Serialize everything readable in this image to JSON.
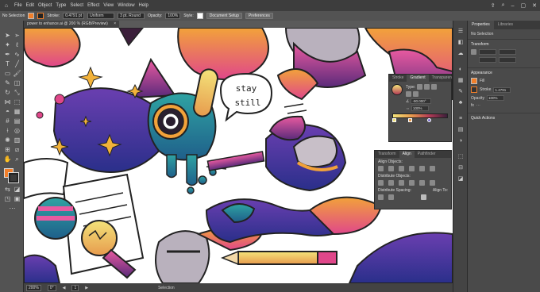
{
  "menubar": {
    "items": [
      "File",
      "Edit",
      "Object",
      "Type",
      "Select",
      "Effect",
      "View",
      "Window",
      "Help"
    ],
    "right_icons": [
      "share-icon",
      "search-icon",
      "minimize-icon",
      "maximize-icon",
      "close-icon"
    ]
  },
  "ctrlbar": {
    "selection_label": "No Selection",
    "stroke_label": "Stroke:",
    "stroke_value": "0.4791 pt",
    "uniform_label": "Uniform",
    "brush_label": "3 pt. Round",
    "opacity_label": "Opacity:",
    "opacity_value": "100%",
    "style_label": "Style:",
    "doc_setup": "Document Setup",
    "preferences": "Preferences"
  },
  "document": {
    "tab_title": "power to enhance.ai @ 200 % (RGB/Preview)",
    "close": "×",
    "speech_line1": "stay",
    "speech_line2": "still"
  },
  "status": {
    "zoom": "200%",
    "angle": "0°",
    "artboard": "1",
    "tool": "Selection"
  },
  "properties": {
    "tabs": [
      "Properties",
      "Libraries"
    ],
    "no_selection": "No Selection",
    "transform": "Transform",
    "appearance": "Appearance",
    "fill": "Fill",
    "stroke": "Stroke",
    "stroke_value": "1.4791",
    "opacity": "Opacity",
    "opacity_value": "100%",
    "fx": "fx",
    "quick_actions": "Quick Actions"
  },
  "gradient_panel": {
    "tabs": [
      "Stroke",
      "Gradient",
      "Transparen"
    ],
    "type_label": "Type:",
    "angle_value": "-90.000°",
    "opacity_label": "100%"
  },
  "align_panel": {
    "tabs": [
      "Transform",
      "Align",
      "Pathfinder"
    ],
    "align_objects": "Align Objects:",
    "distribute_objects": "Distribute Objects:",
    "distribute_spacing": "Distribute Spacing:",
    "align_to": "Align To:"
  },
  "colors": {
    "accent_orange": "#f27f2a",
    "bg_dark": "#323232"
  }
}
